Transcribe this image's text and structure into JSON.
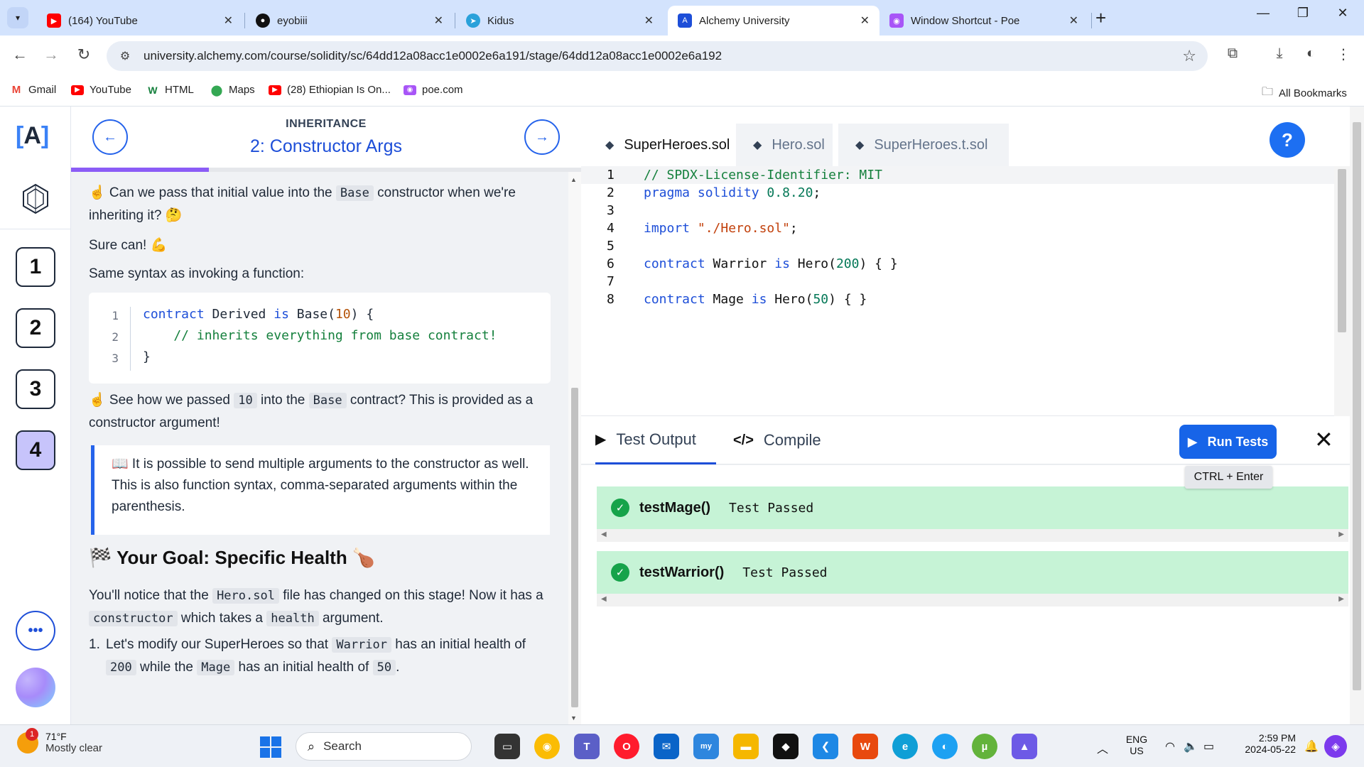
{
  "browser": {
    "tabs": [
      {
        "title": "(164) YouTube",
        "icon": "youtube-icon",
        "color": "#ff0000"
      },
      {
        "title": "eyobiii",
        "icon": "github-icon",
        "color": "#111111"
      },
      {
        "title": "Kidus",
        "icon": "telegram-icon",
        "color": "#2aa1da"
      },
      {
        "title": "Alchemy University",
        "icon": "alchemy-icon",
        "color": "#1d4ed8"
      },
      {
        "title": "Window Shortcut - Poe",
        "icon": "poe-icon",
        "color": "#a855f7"
      }
    ],
    "url": "university.alchemy.com/course/solidity/sc/64dd12a08acc1e0002e6a191/stage/64dd12a08acc1e0002e6a192",
    "bookmarks": [
      "Gmail",
      "YouTube",
      "HTML",
      "Maps",
      "(28) Ethiopian Is On...",
      "poe.com"
    ],
    "all_bookmarks": "All Bookmarks"
  },
  "app": {
    "stages": [
      "1",
      "2",
      "3",
      "4"
    ],
    "active_stage": "4",
    "lesson": {
      "eyebrow": "INHERITANCE",
      "title": "2: Constructor Args",
      "progress_fraction": 0.27,
      "p1a": "☝️ Can we pass that initial value into the ",
      "p1code": "Base",
      "p1b": " constructor when we're inheriting it? 🤔",
      "p2": "Sure can! 💪",
      "p3": "Same syntax as invoking a function:",
      "codeblock": {
        "ln": [
          "1",
          "2",
          "3"
        ],
        "kw1": "contract",
        "name": " Derived ",
        "kw2": "is",
        "base_call": " Base(",
        "arg": "10",
        "tail": ") {",
        "comment": "    // inherits everything from base contract!",
        "close": "}"
      },
      "p4a": "☝️ See how we passed ",
      "p4code1": "10",
      "p4b": " into the ",
      "p4code2": "Base",
      "p4c": " contract? This is provided as a constructor argument!",
      "callout": "📖 It is possible to send multiple arguments to the constructor as well. This is also function syntax, comma-separated arguments within the parenthesis.",
      "goal": "🏁 Your Goal: Specific Health 🍗",
      "p5a": "You'll notice that the ",
      "p5code1": "Hero.sol",
      "p5b": " file has changed on this stage! Now it has a ",
      "p5code2": "constructor",
      "p5c": " which takes a ",
      "p5code3": "health",
      "p5d": " argument.",
      "li_num": "1.",
      "li_a": "Let's modify our SuperHeroes so that ",
      "li_code1": "Warrior",
      "li_b": " has an initial health of ",
      "li_code2": "200",
      "li_c": " while the ",
      "li_code3": "Mage",
      "li_d": " has an initial health of ",
      "li_code4": "50",
      "li_e": "."
    },
    "editor": {
      "tabs": [
        "SuperHeroes.sol",
        "Hero.sol",
        "SuperHeroes.t.sol"
      ],
      "active_tab": "SuperHeroes.sol",
      "line_numbers": [
        "1",
        "2",
        "3",
        "4",
        "5",
        "6",
        "7",
        "8"
      ],
      "l1": "// SPDX-License-Identifier: MIT",
      "l2_kw": "pragma solidity",
      "l2_ver": " 0.8.20",
      "l2_end": ";",
      "l4_kw": "import",
      "l4_str": " \"./Hero.sol\"",
      "l4_end": ";",
      "l6_kw1": "contract",
      "l6_name": " Warrior ",
      "l6_kw2": "is",
      "l6_call": " Hero(",
      "l6_num": "200",
      "l6_end": ") { }",
      "l8_kw1": "contract",
      "l8_name": " Mage ",
      "l8_kw2": "is",
      "l8_call": " Hero(",
      "l8_num": "50",
      "l8_end": ") { }"
    },
    "output": {
      "tabs": [
        "Test Output",
        "Compile"
      ],
      "run_label": "Run Tests",
      "shortcut": "CTRL + Enter",
      "results": [
        {
          "name": "testMage()",
          "status": "Test Passed"
        },
        {
          "name": "testWarrior()",
          "status": "Test Passed"
        }
      ]
    }
  },
  "taskbar": {
    "weather_temp": "71°F",
    "weather_desc": "Mostly clear",
    "notif_count": "1",
    "search": "Search",
    "lang1": "ENG",
    "lang2": "US",
    "time": "2:59 PM",
    "date": "2024-05-22"
  }
}
